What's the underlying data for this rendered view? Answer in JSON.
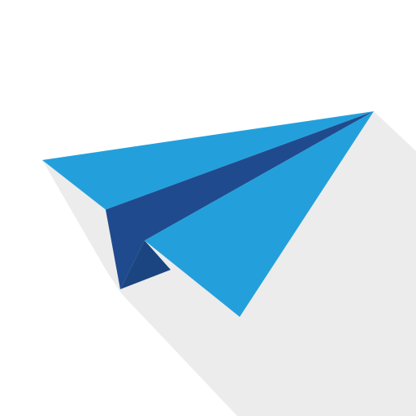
{
  "app_icon": {
    "icon": "paper-plane-icon",
    "colors": {
      "background": "#ffffff",
      "shadow": "#ececec",
      "wing_light": "#23a0dc",
      "wing_dark": "#1f4b8e",
      "tail_dark": "#1a4580"
    }
  }
}
